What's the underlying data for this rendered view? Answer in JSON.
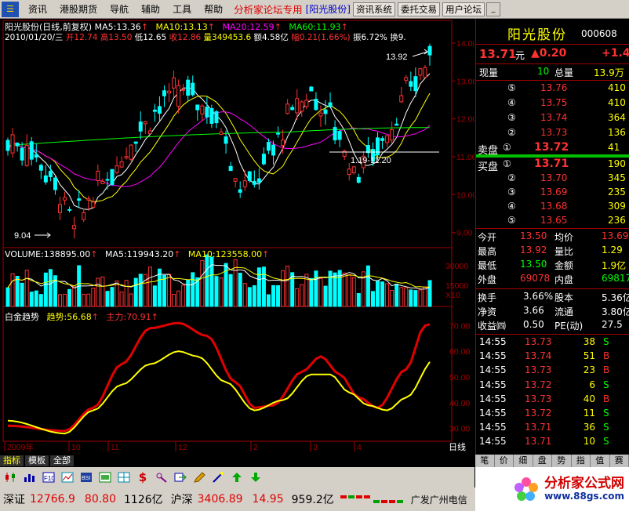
{
  "menubar": {
    "logo": "☰",
    "items": [
      "资讯",
      "港股期货",
      "导航",
      "辅助",
      "工具",
      "帮助"
    ],
    "special": "分析家论坛专用",
    "stock_tag": "[阳光股份]",
    "buttons": [
      "资讯系统",
      "委托交易",
      "用户论坛"
    ]
  },
  "chart": {
    "title_line": "阳光股份(日线,前复权)",
    "ma_labels": [
      {
        "text": "MA5:13.36",
        "color": "#ffffff"
      },
      {
        "text": "MA10:13.13",
        "color": "#ffff00"
      },
      {
        "text": "MA20:12.59",
        "color": "#ff00ff"
      },
      {
        "text": "MA60:11.93",
        "color": "#00ff00"
      }
    ],
    "info_line": {
      "date": "2010/01/20/三",
      "open": "开12.74",
      "high": "高13.50",
      "low": "低12.65",
      "close": "收12.86",
      "vol": "量349453.6",
      "amount": "额4.58亿",
      "range": "幅0.21(1.66%)",
      "amp": "振6.72%",
      "turnover": "换9."
    },
    "annotations": {
      "high": "13.92",
      "low": "9.04",
      "mid": "1.19-11.20"
    },
    "price_axis": [
      "14.00",
      "13.00",
      "12.00",
      "11.00",
      "10.00",
      "9.00"
    ],
    "volume_title": "VOLUME:138895.00",
    "vol_ma5": "MA5:119943.20",
    "vol_ma10": "MA10:123558.00",
    "volume_axis": [
      "30000",
      "15000",
      "X10"
    ],
    "indicator_title": "白金趋势",
    "indicator_trend": "趋势:56.68",
    "indicator_main": "主力:70.91",
    "indicator_axis": [
      "70.00",
      "60.00",
      "50.00",
      "40.00",
      "30.00"
    ],
    "date_labels": [
      "2009年",
      "10",
      "11",
      "12",
      "2",
      "3",
      "4"
    ],
    "period": "日线"
  },
  "quote": {
    "name": "阳光股份",
    "code": "000608",
    "price": "13.71",
    "unit": "元",
    "change": "▲0.20",
    "pct": "+1.4",
    "xianliang_label": "现量",
    "xianliang": "10",
    "zongliang_label": "总量",
    "zongliang": "13.9万",
    "sell_label": "卖盘",
    "buy_label": "买盘",
    "asks": [
      {
        "lvl": "⑤",
        "price": "13.76",
        "vol": "410"
      },
      {
        "lvl": "④",
        "price": "13.75",
        "vol": "410"
      },
      {
        "lvl": "③",
        "price": "13.74",
        "vol": "364"
      },
      {
        "lvl": "②",
        "price": "13.73",
        "vol": "136"
      },
      {
        "lvl": "①",
        "price": "13.72",
        "vol": "41"
      }
    ],
    "bids": [
      {
        "lvl": "①",
        "price": "13.71",
        "vol": "190"
      },
      {
        "lvl": "②",
        "price": "13.70",
        "vol": "345"
      },
      {
        "lvl": "③",
        "price": "13.69",
        "vol": "235"
      },
      {
        "lvl": "④",
        "price": "13.68",
        "vol": "309"
      },
      {
        "lvl": "⑤",
        "price": "13.65",
        "vol": "236"
      }
    ],
    "stats": [
      {
        "l1": "今开",
        "v1": "13.50",
        "l2": "均价",
        "v2": "13.69"
      },
      {
        "l1": "最高",
        "v1": "13.92",
        "l2": "量比",
        "v2": "1.29"
      },
      {
        "l1": "最低",
        "v1": "13.50",
        "l2": "金额",
        "v2": "1.9亿"
      },
      {
        "l1": "外盘",
        "v1": "69078",
        "l2": "内盘",
        "v2": "69817"
      }
    ],
    "stats2": [
      {
        "l1": "换手",
        "v1": "3.66%",
        "l2": "股本",
        "v2": "5.36亿"
      },
      {
        "l1": "净资",
        "v1": "3.66",
        "l2": "流通",
        "v2": "3.80亿"
      },
      {
        "l1": "收益㈣",
        "v1": "0.50",
        "l2": "PE(动)",
        "v2": "27.5"
      }
    ],
    "ticks": [
      {
        "time": "14:55",
        "price": "13.73",
        "vol": "38",
        "side": "S"
      },
      {
        "time": "14:55",
        "price": "13.74",
        "vol": "51",
        "side": "B"
      },
      {
        "time": "14:55",
        "price": "13.73",
        "vol": "23",
        "side": "B"
      },
      {
        "time": "14:55",
        "price": "13.72",
        "vol": "6",
        "side": "S"
      },
      {
        "time": "14:55",
        "price": "13.73",
        "vol": "40",
        "side": "B"
      },
      {
        "time": "14:55",
        "price": "13.72",
        "vol": "11",
        "side": "S"
      },
      {
        "time": "14:55",
        "price": "13.71",
        "vol": "36",
        "side": "S"
      },
      {
        "time": "14:55",
        "price": "13.71",
        "vol": "10",
        "side": "S"
      }
    ]
  },
  "bottom_tabs": [
    "指标",
    "模板",
    "全部"
  ],
  "right_tabs": [
    "笔",
    "价",
    "细",
    "盘",
    "势",
    "指",
    "值",
    "赛"
  ],
  "status": {
    "sz_label": "深证",
    "sz_index": "12766.9",
    "sz_change": "80.80",
    "sz_amount": "1126亿",
    "hs_label": "沪深",
    "hs_index": "3406.89",
    "hs_change": "14.95",
    "hs_amount": "959.2亿",
    "broker": "广发广州电信"
  },
  "logo": {
    "text": "分析家公式网",
    "url": "www.88gs.com"
  },
  "colors": {
    "up": "#ff3232",
    "down": "#00ffff",
    "ma5": "#ffffff",
    "ma10": "#ffff00",
    "ma20": "#ff00ff",
    "ma60": "#00ff00",
    "border": "#a00000"
  }
}
